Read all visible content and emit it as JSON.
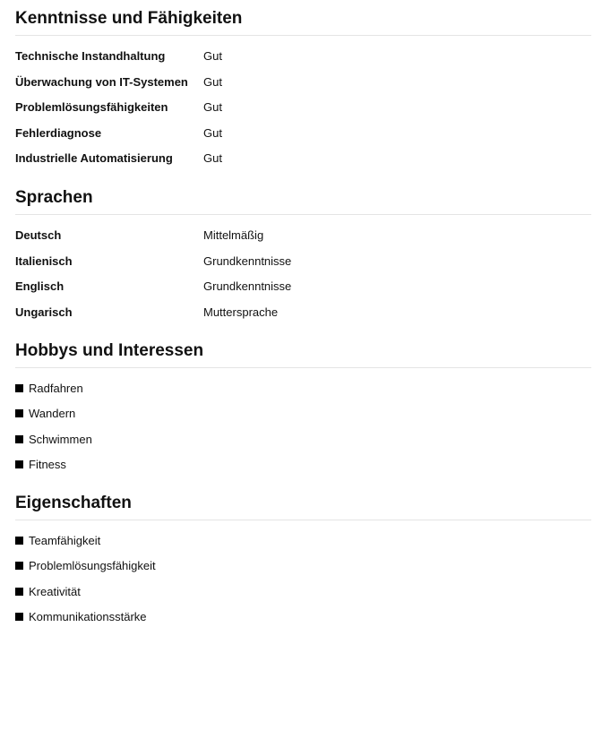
{
  "skills": {
    "title": "Kenntnisse und Fähigkeiten",
    "items": [
      {
        "name": "Technische Instandhaltung",
        "level": "Gut"
      },
      {
        "name": "Überwachung von IT-Systemen",
        "level": "Gut"
      },
      {
        "name": "Problemlösungsfähigkeiten",
        "level": "Gut"
      },
      {
        "name": "Fehlerdiagnose",
        "level": "Gut"
      },
      {
        "name": "Industrielle Automatisierung",
        "level": "Gut"
      }
    ]
  },
  "languages": {
    "title": "Sprachen",
    "items": [
      {
        "name": "Deutsch",
        "level": "Mittelmäßig"
      },
      {
        "name": "Italienisch",
        "level": "Grundkenntnisse"
      },
      {
        "name": "Englisch",
        "level": "Grundkenntnisse"
      },
      {
        "name": "Ungarisch",
        "level": "Muttersprache"
      }
    ]
  },
  "hobbies": {
    "title": "Hobbys und Interessen",
    "items": [
      "Radfahren",
      "Wandern",
      "Schwimmen",
      "Fitness"
    ]
  },
  "traits": {
    "title": "Eigenschaften",
    "items": [
      "Teamfähigkeit",
      "Problemlösungsfähigkeit",
      "Kreativität",
      "Kommunikationsstärke"
    ]
  }
}
